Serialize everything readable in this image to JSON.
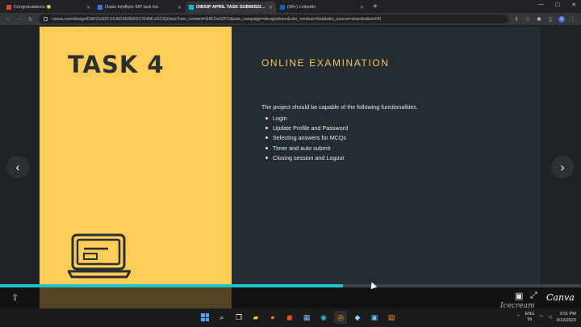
{
  "browser": {
    "tabs": [
      {
        "label": "Congratulations 🌟",
        "favicon_color": "#e94235",
        "active": false
      },
      {
        "label": "Oasis InfoByte SIP task list",
        "favicon_color": "#3b78e7",
        "active": false
      },
      {
        "label": "OIBSIP APRIL TASK SUBMISSION",
        "favicon_color": "#00c4cc",
        "active": true
      },
      {
        "label": "(99+) LinkedIn",
        "favicon_color": "#0a66c2",
        "active": false
      }
    ],
    "new_tab_symbol": "+",
    "url": "canva.com/design/DAFZw3ZF1I/UkG9G9b2GCXhIMLxGCIQ/view?utm_content=DAFZw3ZF1I&utm_campaign=designshare&utm_medium=link&utm_source=sharebutton#20"
  },
  "slide": {
    "left_title": "TASK 4",
    "heading": "ONLINE EXAMINATION",
    "description": "The project should be capable of the following functionalities.",
    "features": [
      "Login",
      "Update Profile and Password",
      "Selecting answers for MCQs",
      "Timer and auto submit",
      "Closing session and Logout"
    ],
    "left_color": "#fecd58",
    "right_color": "#242b31",
    "heading_color": "#f4c85a"
  },
  "viewer": {
    "prev_symbol": "‹",
    "next_symbol": "›",
    "progress_fraction": 0.59,
    "progress_color": "#1fc3c8",
    "logo_text": "Canva",
    "watermark_text": "Icecream"
  },
  "taskbar": {
    "lang": "ENG\nIN",
    "time": "3:51 PM",
    "date": "4/19/2023"
  },
  "icons": [
    "share-icon",
    "comment-icon",
    "fullscreen-icon",
    "lock-icon",
    "star-icon",
    "extensions-icon",
    "windows-start-icon",
    "search-icon",
    "laptop-icon"
  ]
}
